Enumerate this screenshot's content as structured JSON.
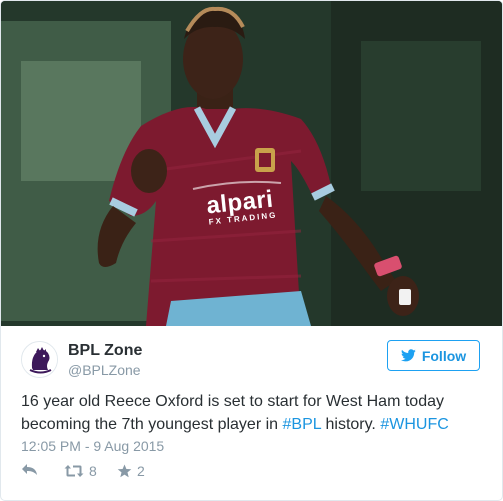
{
  "tweet": {
    "media": {
      "sponsor_text": "alpari",
      "sponsor_subtext": "FX TRADING"
    },
    "author": {
      "display_name": "BPL Zone",
      "handle": "@BPLZone",
      "avatar_icon": "premier-league-lion-icon"
    },
    "follow_button": {
      "label": "Follow",
      "icon": "twitter-bird-icon",
      "color": "#1da1f2"
    },
    "text": {
      "part1": "16 year old Reece Oxford is set to start for West Ham today becoming the 7th youngest player in ",
      "hashtag1": "#BPL",
      "part2": " history. ",
      "hashtag2": "#WHUFC"
    },
    "timestamp": "12:05 PM - 9 Aug 2015",
    "actions": {
      "reply_icon": "reply-icon",
      "retweet_icon": "retweet-icon",
      "retweet_count": "8",
      "favorite_icon": "star-icon",
      "favorite_count": "2"
    }
  }
}
